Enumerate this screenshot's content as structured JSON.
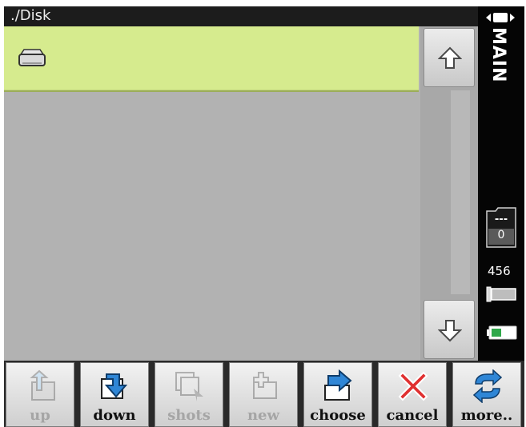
{
  "title": {
    "path": "./Disk"
  },
  "file_list": {
    "items": [
      {
        "icon": "drive-icon",
        "label": "",
        "selected": true
      }
    ]
  },
  "scrollbar": {
    "up_icon": "arrow-up-icon",
    "down_icon": "arrow-down-icon"
  },
  "side_panel": {
    "mode": "MAIN",
    "folder": {
      "label": "---",
      "count": "0"
    },
    "storage": "456"
  },
  "toolbar": {
    "buttons": [
      {
        "label": "up",
        "icon": "folder-up-icon",
        "enabled": false
      },
      {
        "label": "down",
        "icon": "folder-down-icon",
        "enabled": true
      },
      {
        "label": "shots",
        "icon": "shots-icon",
        "enabled": false
      },
      {
        "label": "new",
        "icon": "new-folder-icon",
        "enabled": false
      },
      {
        "label": "choose",
        "icon": "choose-icon",
        "enabled": true
      },
      {
        "label": "cancel",
        "icon": "cancel-icon",
        "enabled": true
      },
      {
        "label": "more..",
        "icon": "refresh-icon",
        "enabled": true
      }
    ]
  },
  "colors": {
    "selection": "#d6eb8e",
    "background": "#b3b3b3",
    "side_panel": "#050505",
    "accent_blue": "#2f86d6",
    "cancel_red": "#e03030"
  }
}
